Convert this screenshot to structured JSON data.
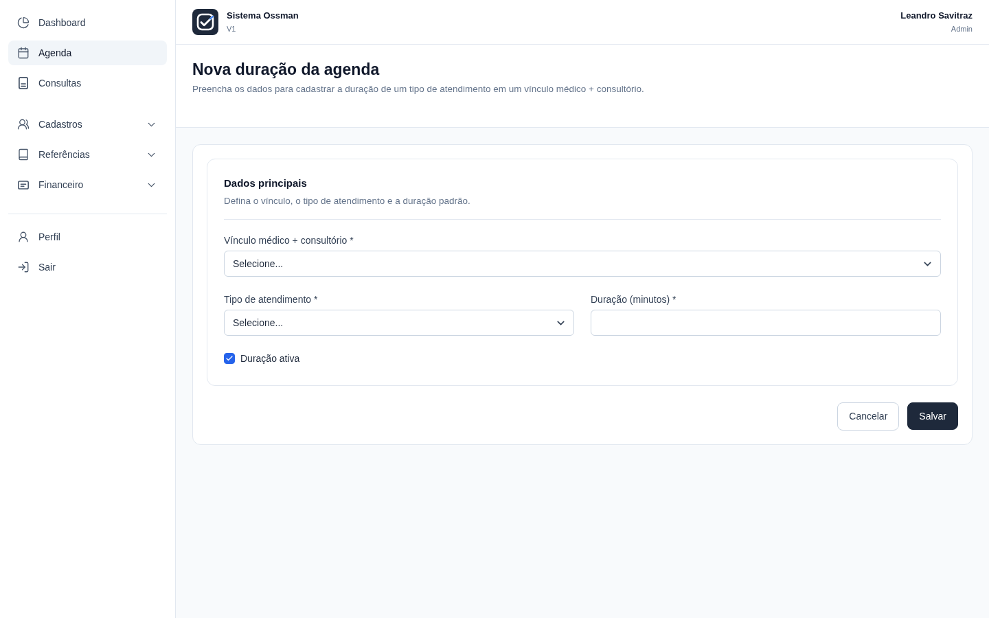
{
  "sidebar": {
    "sections": [
      {
        "items": [
          {
            "label": "Dashboard",
            "kind": "link",
            "selected": false
          },
          {
            "label": "Agenda",
            "kind": "link",
            "selected": true
          },
          {
            "label": "Consultas",
            "kind": "link",
            "selected": false
          }
        ]
      },
      {
        "items": [
          {
            "label": "Cadastros",
            "kind": "group",
            "selected": false,
            "expanded": false
          },
          {
            "label": "Referências",
            "kind": "group",
            "selected": false,
            "expanded": false
          },
          {
            "label": "Financeiro",
            "kind": "group",
            "selected": false,
            "expanded": false
          }
        ]
      }
    ],
    "account_items": [
      {
        "label": "Perfil",
        "selected": false
      },
      {
        "label": "Sair",
        "selected": false
      }
    ]
  },
  "header": {
    "app_name": "Sistema Ossman",
    "version": "V1",
    "user_name": "Leandro Savitraz",
    "user_role": "Admin"
  },
  "page": {
    "title": "Nova duração da agenda",
    "subtitle": "Preencha os dados para cadastrar a duração de um tipo de atendimento em um vínculo médico + consultório."
  },
  "form": {
    "section_title": "Dados principais",
    "section_description": "Defina o vínculo, o tipo de atendimento e a duração padrão.",
    "rows": [
      [
        {
          "kind": "select",
          "label": "Vínculo médico + consultório *",
          "placeholder": "Selecione..."
        }
      ],
      [
        {
          "kind": "select",
          "label": "Tipo de atendimento *",
          "placeholder": "Selecione..."
        },
        {
          "kind": "input",
          "label": "Duração (minutos) *"
        }
      ]
    ],
    "checkbox": {
      "label": "Duração ativa",
      "checked": true
    }
  },
  "buttons": [
    {
      "label": "Cancelar",
      "kind": "secondary"
    },
    {
      "label": "Salvar",
      "kind": "primary"
    }
  ]
}
